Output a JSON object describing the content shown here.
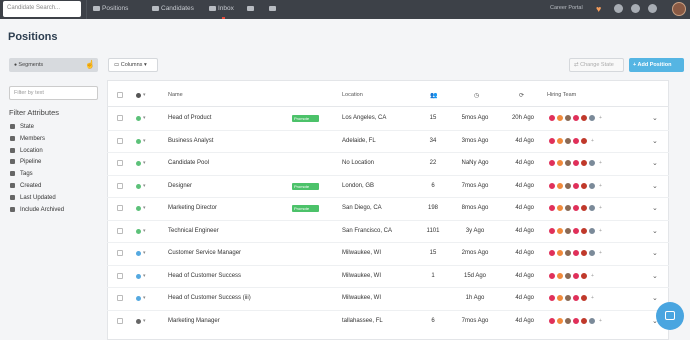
{
  "nav": {
    "search_placeholder": "Candidate Search...",
    "positions": "Positions",
    "candidates": "Candidates",
    "inbox": "Inbox",
    "career_portal": "Career Portal"
  },
  "page": {
    "title": "Positions"
  },
  "toolbar": {
    "segments": "Segments",
    "columns": "Columns",
    "change_state": "Change State",
    "add_position": "+ Add Position"
  },
  "filters": {
    "placeholder": "Filter by text",
    "title": "Filter Attributes",
    "items": [
      "State",
      "Members",
      "Location",
      "Pipeline",
      "Tags",
      "Created",
      "Last Updated",
      "Include Archived"
    ]
  },
  "table": {
    "headers": {
      "name": "Name",
      "location": "Location",
      "team": "Hiring Team"
    },
    "promote_label": "Promote",
    "rows": [
      {
        "name": "Head of Product",
        "promote": true,
        "location": "Los Angeles, CA",
        "count": "15",
        "created": "5mos Ago",
        "updated": "20h Ago",
        "status": "#5cc179",
        "team_size": 6
      },
      {
        "name": "Business Analyst",
        "promote": false,
        "location": "Adelaide, FL",
        "count": "34",
        "created": "3mos Ago",
        "updated": "4d Ago",
        "status": "#5cc179",
        "team_size": 5
      },
      {
        "name": "Candidate Pool",
        "promote": false,
        "location": "No Location",
        "count": "22",
        "created": "NaNy Ago",
        "updated": "4d Ago",
        "status": "#5cc179",
        "team_size": 6
      },
      {
        "name": "Designer",
        "promote": true,
        "location": "London, GB",
        "count": "6",
        "created": "7mos Ago",
        "updated": "4d Ago",
        "status": "#5cc179",
        "team_size": 6
      },
      {
        "name": "Marketing Director",
        "promote": true,
        "location": "San Diego, CA",
        "count": "198",
        "created": "8mos Ago",
        "updated": "4d Ago",
        "status": "#5cc179",
        "team_size": 6
      },
      {
        "name": "Technical Engineer",
        "promote": false,
        "location": "San Francisco, CA",
        "count": "1101",
        "created": "3y Ago",
        "updated": "4d Ago",
        "status": "#5cc179",
        "team_size": 6
      },
      {
        "name": "Customer Service Manager",
        "promote": false,
        "location": "Milwaukee, WI",
        "count": "15",
        "created": "2mos Ago",
        "updated": "4d Ago",
        "status": "#55a9e0",
        "team_size": 6
      },
      {
        "name": "Head of Customer Success",
        "promote": false,
        "location": "Milwaukee, WI",
        "count": "1",
        "created": "15d Ago",
        "updated": "4d Ago",
        "status": "#55a9e0",
        "team_size": 5
      },
      {
        "name": "Head of Customer Success (iii)",
        "promote": false,
        "location": "Milwaukee, WI",
        "count": "",
        "created": "1h Ago",
        "updated": "4d Ago",
        "status": "#55a9e0",
        "team_size": 5
      },
      {
        "name": "Marketing Manager",
        "promote": false,
        "location": "tallahassee, FL",
        "count": "6",
        "created": "7mos Ago",
        "updated": "4d Ago",
        "status": "#666666",
        "team_size": 6
      }
    ]
  },
  "colors": {
    "nav_bg": "#3d4148",
    "accent": "#55b5e3",
    "promote": "#4cc26a",
    "team_red": "#e0305a"
  }
}
